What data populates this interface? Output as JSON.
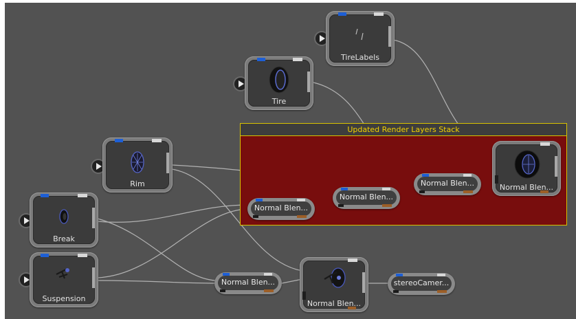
{
  "group": {
    "title": "Updated Render Layers Stack"
  },
  "nodes": {
    "tire_labels": {
      "label": "TireLabels",
      "icon": "tire-labels-thumbnail"
    },
    "tire": {
      "label": "Tire",
      "icon": "tire-thumbnail"
    },
    "rim": {
      "label": "Rim",
      "icon": "rim-thumbnail"
    },
    "break": {
      "label": "Break",
      "icon": "brake-thumbnail"
    },
    "suspension": {
      "label": "Suspension",
      "icon": "suspension-thumbnail"
    },
    "blend_final_group": {
      "label": "Normal Blen..."
    },
    "blend_final_bottom": {
      "label": "Normal Blen..."
    }
  },
  "blend_pills": {
    "group_1": {
      "label": "Normal Blen..."
    },
    "group_2": {
      "label": "Normal Blen..."
    },
    "group_3": {
      "label": "Normal Blen..."
    },
    "bottom": {
      "label": "Normal Blen..."
    }
  },
  "stereo_camera": {
    "label": "stereoCamer..."
  },
  "colors": {
    "canvas": "#525252",
    "group_fill": "#780d0d",
    "group_border": "#d8c200",
    "group_title": "#f2d000",
    "port_blue": "#1d5fd6",
    "port_orange": "#9c5e27"
  }
}
